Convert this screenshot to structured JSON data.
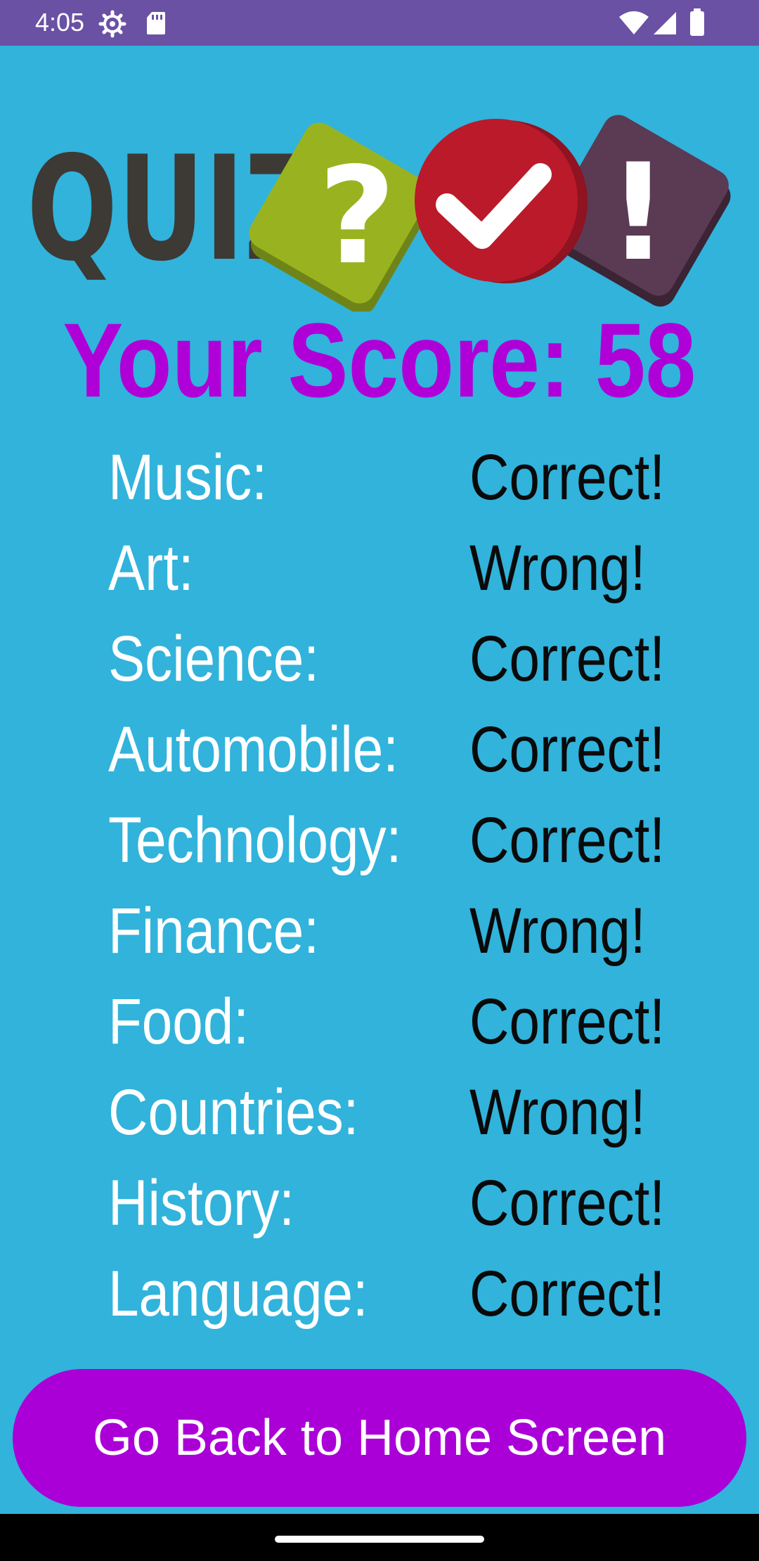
{
  "status_bar": {
    "time": "4:05",
    "icons": [
      "settings-gear-icon",
      "sd-card-icon",
      "wifi-icon",
      "cellular-signal-icon",
      "battery-icon"
    ]
  },
  "logo": {
    "text": "QUIZ",
    "question_mark": "?",
    "exclamation": "!",
    "colors": {
      "text": "#3d3935",
      "green": "#99b320",
      "red": "#ba1a2a",
      "purple": "#5b3a54"
    }
  },
  "score": {
    "label": "Your Score:",
    "value": "58",
    "color": "#b000d8"
  },
  "results": [
    {
      "category": "Music:",
      "result": "Correct!"
    },
    {
      "category": "Art:",
      "result": "Wrong!"
    },
    {
      "category": "Science:",
      "result": "Correct!"
    },
    {
      "category": "Automobile:",
      "result": "Correct!"
    },
    {
      "category": "Technology:",
      "result": "Correct!"
    },
    {
      "category": "Finance:",
      "result": "Wrong!"
    },
    {
      "category": "Food:",
      "result": "Correct!"
    },
    {
      "category": "Countries:",
      "result": "Wrong!"
    },
    {
      "category": "History:",
      "result": "Correct!"
    },
    {
      "category": "Language:",
      "result": "Correct!"
    }
  ],
  "home_button": {
    "label": "Go Back to Home Screen",
    "color": "#aa00d7"
  },
  "theme": {
    "background": "#31b3db",
    "status_bar": "#6a51a4"
  }
}
